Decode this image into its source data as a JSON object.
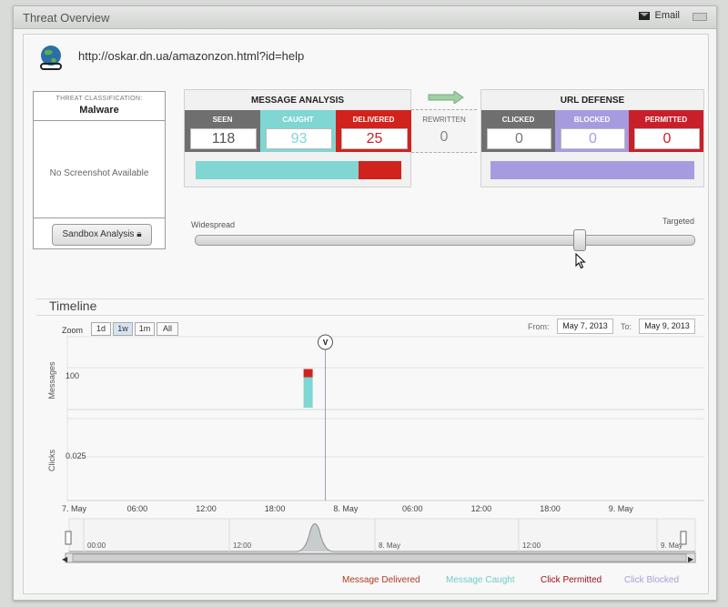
{
  "window": {
    "title": "Threat Overview",
    "email_label": "Email"
  },
  "threat": {
    "url": "http://oskar.dn.ua/amazonzon.html?id=help"
  },
  "classification": {
    "label": "THREAT CLASSIFICATION:",
    "value": "Malware",
    "no_screenshot": "No Screenshot Available",
    "sandbox_button": "Sandbox Analysis"
  },
  "message_analysis": {
    "title": "MESSAGE ANALYSIS",
    "seen": {
      "label": "SEEN",
      "value": "118"
    },
    "caught": {
      "label": "CAUGHT",
      "value": "93"
    },
    "delivered": {
      "label": "DELIVERED",
      "value": "25"
    },
    "caught_fraction": 0.79
  },
  "rewritten": {
    "label": "REWRITTEN",
    "value": "0"
  },
  "url_defense": {
    "title": "URL DEFENSE",
    "clicked": {
      "label": "CLICKED",
      "value": "0"
    },
    "blocked": {
      "label": "BLOCKED",
      "value": "0"
    },
    "permitted": {
      "label": "PERMITTED",
      "value": "0"
    }
  },
  "targeting_slider": {
    "left_label": "Widespread",
    "right_label": "Targeted",
    "level": 0.77
  },
  "timeline": {
    "title": "Timeline",
    "zoom_label": "Zoom",
    "zoom_options": [
      "1d",
      "1w",
      "1m",
      "All"
    ],
    "zoom_selected": "1w",
    "from_label": "From:",
    "from_date": "May 7, 2013",
    "to_label": "To:",
    "to_date": "May 9, 2013"
  },
  "colors": {
    "seen": "#6e6f6e",
    "caught": "#7fd6d3",
    "delivered": "#d0231d",
    "clicked": "#6e6f6e",
    "blocked": "#a79be0",
    "permitted": "#c8202a",
    "caught_text": "#6fcdc9",
    "delivered_text": "#b23a24",
    "permitted_text": "#a01020",
    "blocked_text": "#a7a0d8"
  },
  "chart_data": {
    "type": "bar",
    "panels": [
      "Messages",
      "Clicks"
    ],
    "ylabels": {
      "messages": "Messages",
      "clicks": "Clicks"
    },
    "yticks": {
      "messages": "100",
      "clicks": "0.025"
    },
    "x_ticks": [
      "7. May",
      "06:00",
      "12:00",
      "18:00",
      "8. May",
      "06:00",
      "12:00",
      "18:00",
      "9. May"
    ],
    "navigator_ticks": [
      "00:00",
      "12:00",
      "8. May",
      "12:00",
      "9. May"
    ],
    "series": [
      {
        "name": "Message Delivered",
        "values": [
          25
        ]
      },
      {
        "name": "Message Caught",
        "values": [
          93
        ]
      },
      {
        "name": "Click Permitted",
        "values": [
          0
        ]
      },
      {
        "name": "Click Blocked",
        "values": [
          0
        ]
      }
    ],
    "bar_time_hours": 21,
    "marker_label": "V",
    "marker_time_hours": 22.5
  }
}
